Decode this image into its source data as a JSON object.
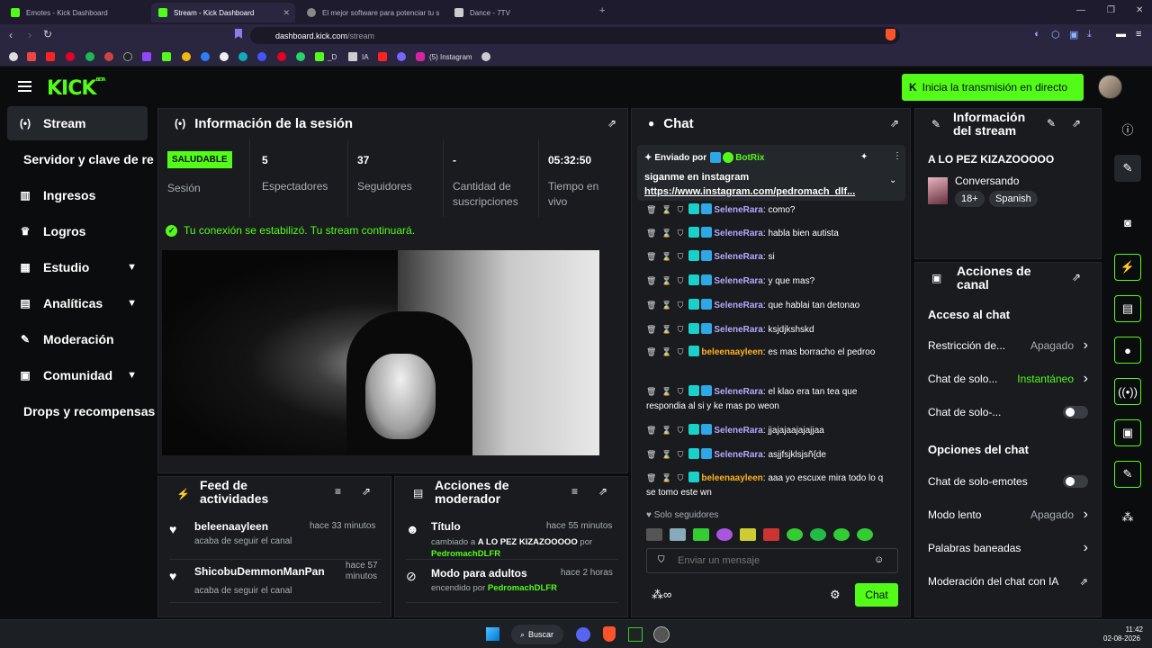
{
  "browser": {
    "tabs": [
      {
        "label": "Emotes - Kick Dashboard",
        "active": false
      },
      {
        "label": "Stream - Kick Dashboard",
        "active": true
      },
      {
        "label": "El mejor software para potenciar tu s",
        "active": false
      },
      {
        "label": "Dance - 7TV",
        "active": false
      }
    ],
    "url_host": "dashboard.kick.com",
    "url_path": "/stream",
    "bookmarks": [
      {
        "label": "_D"
      },
      {
        "label": "IA"
      },
      {
        "label": "(5) Instagram"
      }
    ]
  },
  "topbar": {
    "logo": "KICK",
    "logo_sup": "BETA",
    "go_live_label": "Inicia la transmisión en directo"
  },
  "sidebar": {
    "items": [
      {
        "label": "Stream",
        "icon": "broadcast-icon",
        "active": true
      },
      {
        "label": "Servidor y clave de re",
        "icon": "",
        "active": false
      },
      {
        "label": "Ingresos",
        "icon": "income-icon",
        "active": false
      },
      {
        "label": "Logros",
        "icon": "trophy-icon",
        "active": false
      },
      {
        "label": "Estudio",
        "icon": "studio-icon",
        "active": false,
        "expandable": true
      },
      {
        "label": "Analíticas",
        "icon": "analytics-icon",
        "active": false,
        "expandable": true
      },
      {
        "label": "Moderación",
        "icon": "wrench-icon",
        "active": false
      },
      {
        "label": "Comunidad",
        "icon": "community-icon",
        "active": false,
        "expandable": true
      },
      {
        "label": "Drops y recompensas",
        "icon": "",
        "active": false
      }
    ]
  },
  "session": {
    "title": "Información de la sesión",
    "health_badge": "SALUDABLE",
    "health_label": "Sesión",
    "stats": [
      {
        "value": "5",
        "label": "Espectadores"
      },
      {
        "value": "37",
        "label": "Seguidores"
      },
      {
        "value": "-",
        "label": "Cantidad de suscripciones"
      },
      {
        "value": "05:32:50",
        "label": "Tiempo en vivo"
      }
    ],
    "status_message": "Tu conexión se estabilizó. Tu stream continuará."
  },
  "activity_feed": {
    "title": "Feed de actividades",
    "items": [
      {
        "user": "beleenaayleen",
        "time": "hace 33 minutos",
        "action": "acaba de seguir el canal"
      },
      {
        "user": "ShicobuDemmonManPan",
        "time": "hace 57 minutos",
        "action": "acaba de seguir el canal"
      }
    ]
  },
  "mod_actions": {
    "title": "Acciones de moderador",
    "items": [
      {
        "title": "Título",
        "time": "hace 55 minutos",
        "desc_prefix": "cambiado a ",
        "desc_value": "A LO PEZ KIZAZOOOOO",
        "desc_by": " por ",
        "desc_user": "PedromachDLFR"
      },
      {
        "title": "Modo para adultos",
        "time": "hace 2 horas",
        "desc_prefix": "encendido por ",
        "desc_value": "",
        "desc_by": "",
        "desc_user": "PedromachDLFR"
      }
    ]
  },
  "chat": {
    "title": "Chat",
    "pinned": {
      "sent_by": "Enviado por",
      "user": "BotRix",
      "text": "siganme en instagram",
      "link": "https://www.instagram.com/pedromach_dlf..."
    },
    "messages": [
      {
        "user": "SeleneRara",
        "color": "#b6a8ff",
        "badge": "b2",
        "text": "como?"
      },
      {
        "user": "SeleneRara",
        "color": "#b6a8ff",
        "badge": "b2",
        "text": "habla bien autista"
      },
      {
        "user": "SeleneRara",
        "color": "#b6a8ff",
        "badge": "b2",
        "text": "si"
      },
      {
        "user": "SeleneRara",
        "color": "#b6a8ff",
        "badge": "b2",
        "text": "y que mas?"
      },
      {
        "user": "SeleneRara",
        "color": "#b6a8ff",
        "badge": "b2",
        "text": "que hablai tan detonao"
      },
      {
        "user": "SeleneRara",
        "color": "#b6a8ff",
        "badge": "b2",
        "text": "ksjdjkshskd"
      },
      {
        "user": "beleenaayleen",
        "color": "#ffb020",
        "badge": "",
        "text": "es mas borracho el pedroo"
      },
      {
        "user": "SeleneRara",
        "color": "#b6a8ff",
        "badge": "b2",
        "text": "el klao era tan tea que respondia al si y ke mas po weon"
      },
      {
        "user": "SeleneRara",
        "color": "#b6a8ff",
        "badge": "b2",
        "text": "jjajajaajajajjaa"
      },
      {
        "user": "SeleneRara",
        "color": "#b6a8ff",
        "badge": "b2",
        "text": "asjjfsjklsjsñ{de"
      },
      {
        "user": "beleenaayleen",
        "color": "#ffb020",
        "badge": "",
        "text": "aaa yo escuxe mira todo lo q se tomo este wn"
      }
    ],
    "followers_only": "Solo seguidores",
    "input_placeholder": "Enviar un mensaje",
    "send_label": "Chat"
  },
  "stream_info": {
    "title_line1": "Información",
    "title_line2": "del stream",
    "stream_title": "A LO PEZ KIZAZOOOOO",
    "category": "Conversando",
    "tags": [
      "18+",
      "Spanish"
    ]
  },
  "channel_actions": {
    "title_line1": "Acciones de",
    "title_line2": "canal",
    "chat_access_heading": "Acceso al chat",
    "rows1": [
      {
        "label": "Restricción de...",
        "value": "Apagado",
        "type": "arrow",
        "value_color": "#a8adb5"
      },
      {
        "label": "Chat de solo...",
        "value": "Instantáneo",
        "type": "arrow",
        "value_color": "#53fc18"
      },
      {
        "label": "Chat de solo-...",
        "value": "",
        "type": "toggle",
        "value_color": "#a8adb5"
      }
    ],
    "chat_options_heading": "Opciones del chat",
    "rows2": [
      {
        "label": "Chat de solo-emotes",
        "value": "",
        "type": "toggle",
        "value_color": "#a8adb5"
      },
      {
        "label": "Modo lento",
        "value": "Apagado",
        "type": "arrow",
        "value_color": "#a8adb5"
      },
      {
        "label": "Palabras baneadas",
        "value": "",
        "type": "arrow",
        "value_color": "#a8adb5"
      },
      {
        "label": "Moderación del chat con IA",
        "value": "",
        "type": "external",
        "value_color": "#a8adb5"
      }
    ]
  },
  "taskbar": {
    "search_label": "Buscar",
    "time": "11:42",
    "date": "02-08-2026"
  },
  "colors": {
    "accent": "#53fc18",
    "panel": "#191b1f",
    "bg": "#0b0c0d"
  }
}
